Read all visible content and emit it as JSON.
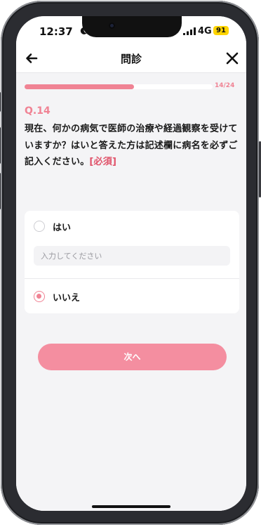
{
  "status": {
    "time": "12:37",
    "network": "4G",
    "battery": "91"
  },
  "header": {
    "title": "問診"
  },
  "progress": {
    "label": "14/24",
    "current": 14,
    "total": 24
  },
  "question": {
    "number": "Q.14",
    "text": "現在、何かの病気で医師の治療や経過観察を受けていますか？はいと答えた方は記述欄に病名を必ずご記入ください。",
    "required": "[必須]"
  },
  "options": [
    {
      "label": "はい",
      "selected": false
    },
    {
      "label": "いいえ",
      "selected": true
    }
  ],
  "input": {
    "placeholder": "入力してください",
    "value": ""
  },
  "next_button": {
    "label": "次へ"
  },
  "colors": {
    "accent": "#f08394",
    "required": "#e05269",
    "button": "#f48ea0",
    "battery": "#ffd400"
  },
  "icons": {
    "back": "arrow-left-icon",
    "close": "close-icon",
    "moon": "moon-icon",
    "signal": "signal-bars-icon"
  }
}
